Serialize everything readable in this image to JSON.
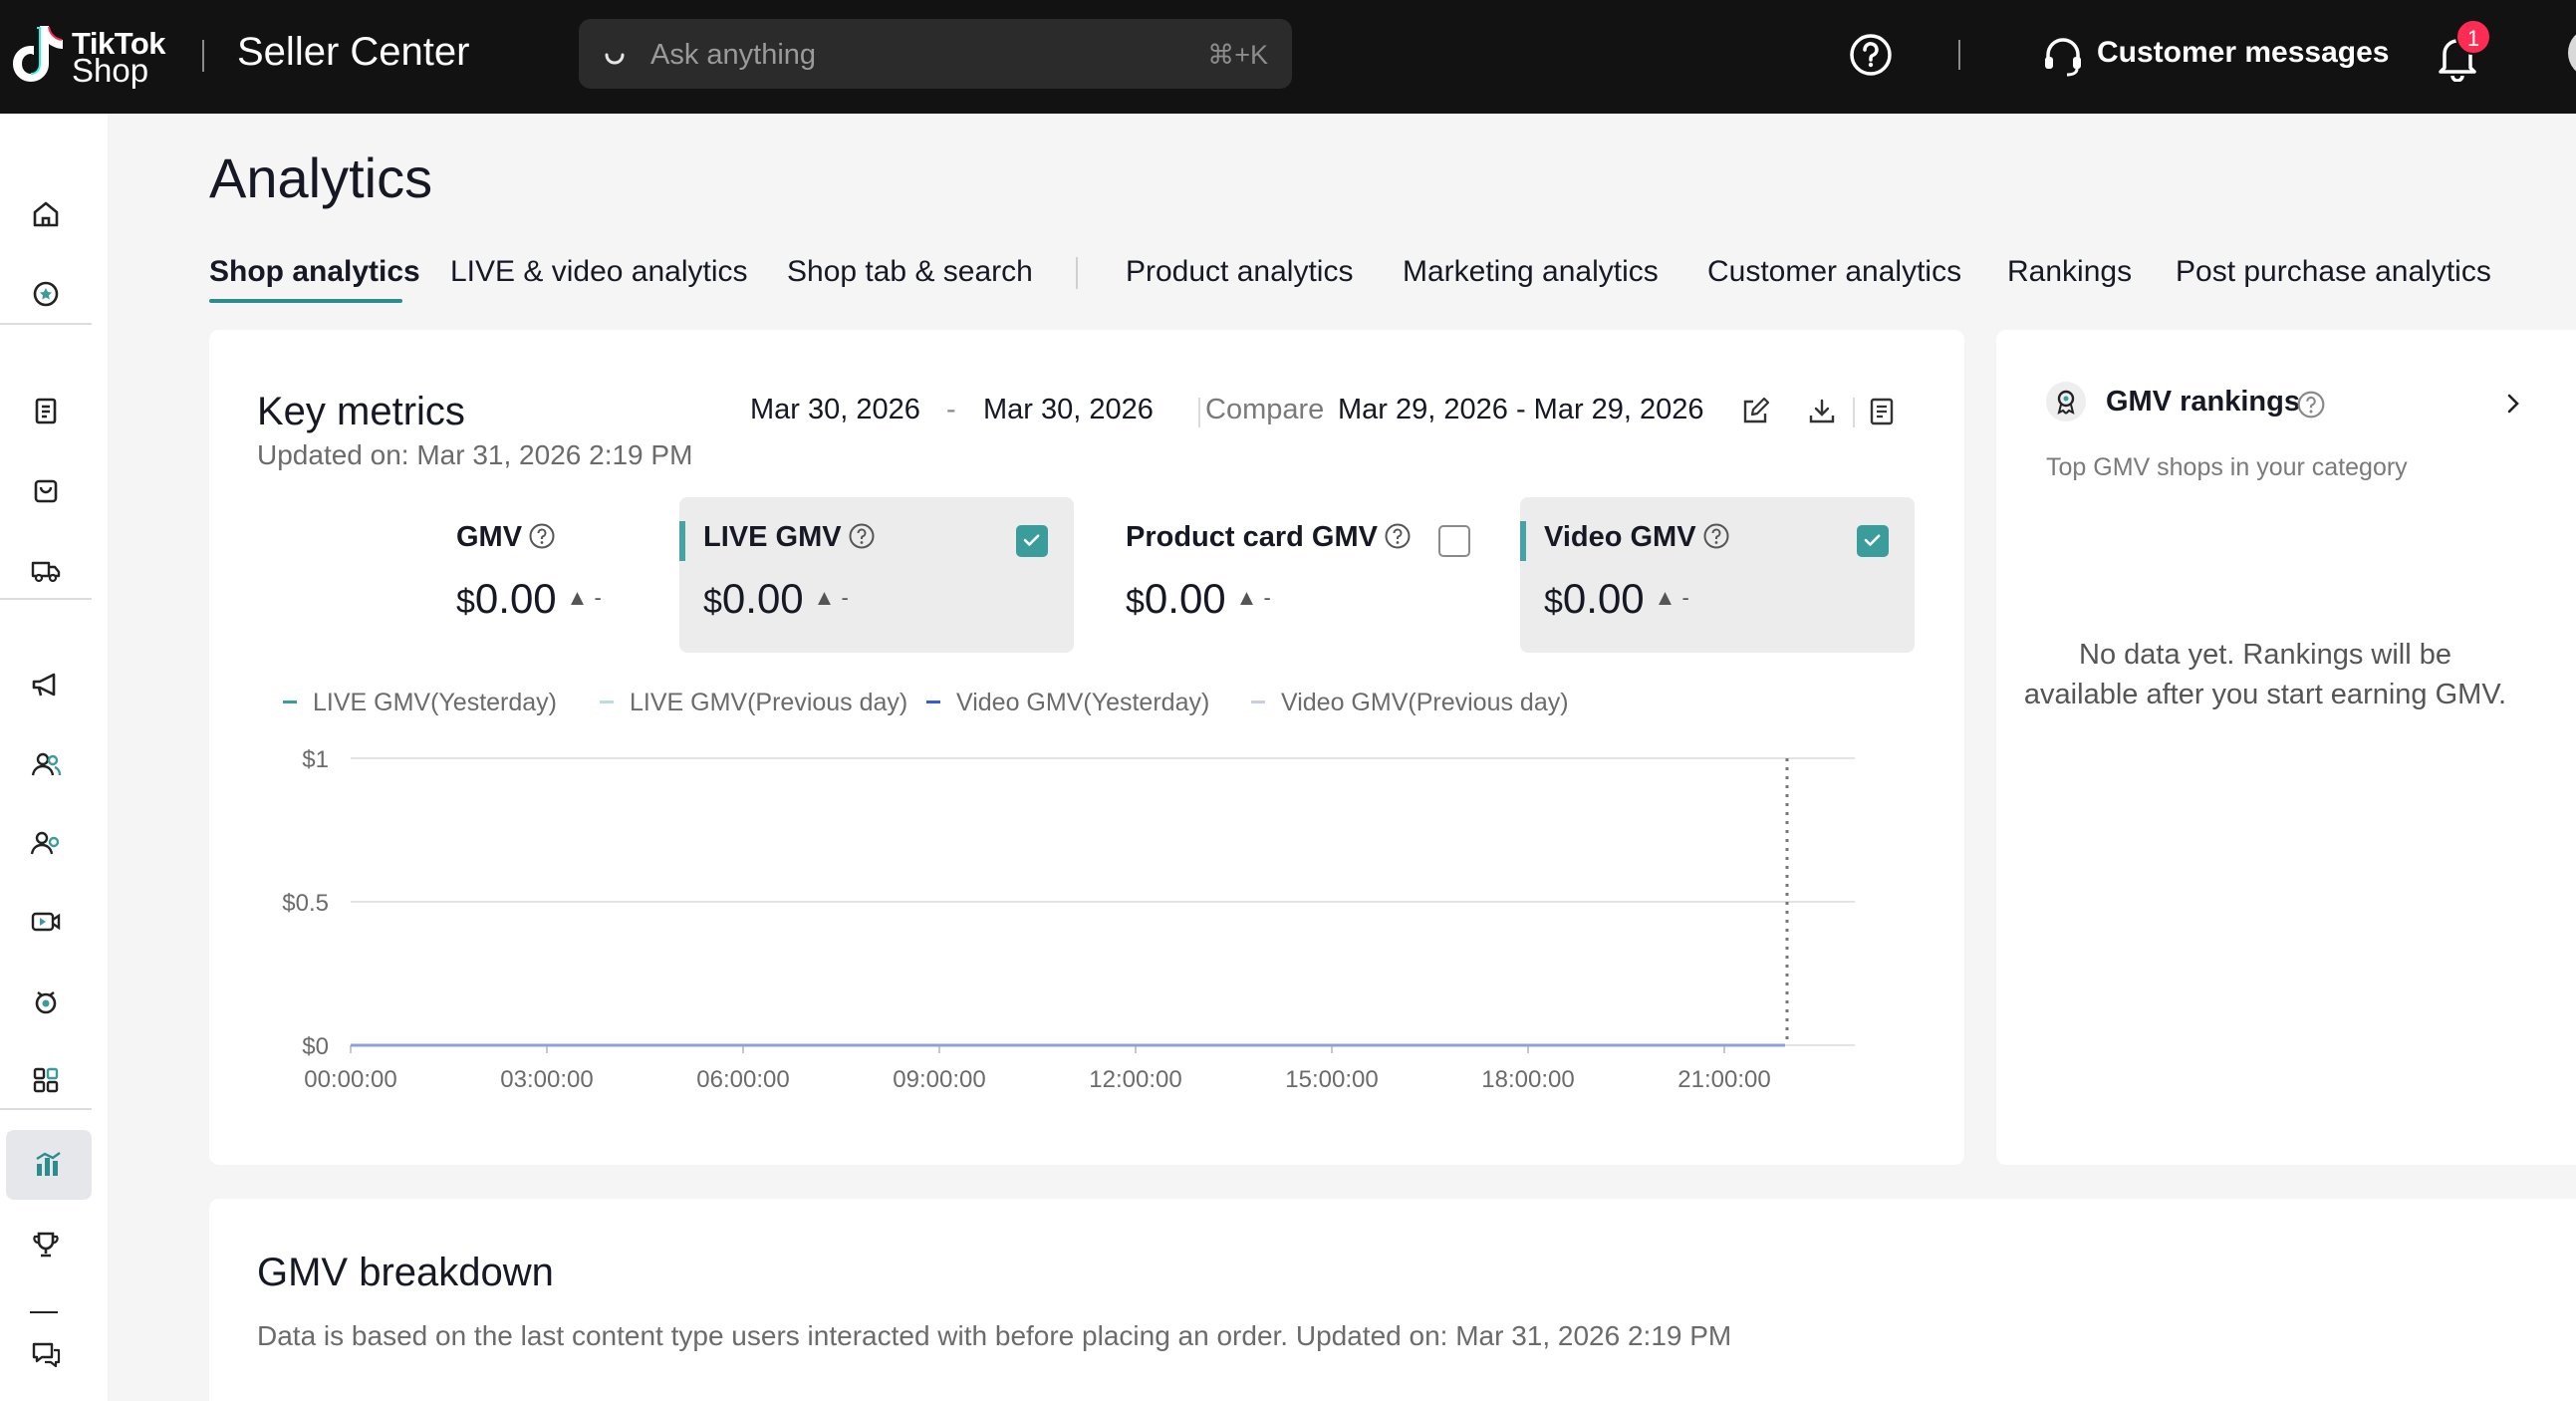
{
  "topbar": {
    "logo_line1": "TikTok",
    "logo_line2": "Shop",
    "app_title": "Seller Center",
    "search": {
      "placeholder": "Ask anything",
      "shortcut": "⌘+K"
    },
    "customer_messages_label": "Customer messages",
    "notification_count": "1"
  },
  "sidebar": {
    "items": [
      {
        "icon": "home-icon"
      },
      {
        "icon": "star-badge-icon"
      },
      {
        "icon": "clipboard-icon"
      },
      {
        "icon": "shopping-bag-icon"
      },
      {
        "icon": "delivery-truck-icon"
      },
      {
        "icon": "megaphone-icon"
      },
      {
        "icon": "users-icon"
      },
      {
        "icon": "user-group-icon"
      },
      {
        "icon": "video-camera-icon"
      },
      {
        "icon": "alarm-badge-icon"
      },
      {
        "icon": "apps-grid-icon"
      },
      {
        "icon": "analytics-chart-icon",
        "active": true
      },
      {
        "icon": "trophy-icon"
      },
      {
        "icon": "chat-icon"
      }
    ]
  },
  "page": {
    "title": "Analytics",
    "tabs": [
      {
        "label": "Shop analytics",
        "active": true
      },
      {
        "label": "LIVE & video analytics"
      },
      {
        "label": "Shop tab & search"
      },
      {
        "label": "Product analytics"
      },
      {
        "label": "Marketing analytics"
      },
      {
        "label": "Customer analytics"
      },
      {
        "label": "Rankings"
      },
      {
        "label": "Post purchase analytics"
      }
    ]
  },
  "key_metrics": {
    "title": "Key metrics",
    "updated": "Updated on: Mar 31, 2026 2:19 PM",
    "date_start": "Mar 30, 2026",
    "date_dash": "-",
    "date_end": "Mar 30, 2026",
    "compare_label": "Compare",
    "compare_range": "Mar 29, 2026 - Mar 29, 2026",
    "metrics": [
      {
        "label": "GMV",
        "currency": "$",
        "value": "0.00",
        "trend": "▲ -",
        "checked": false,
        "selected": false
      },
      {
        "label": "LIVE GMV",
        "currency": "$",
        "value": "0.00",
        "trend": "▲ -",
        "checked": true,
        "selected": true
      },
      {
        "label": "Product card GMV",
        "currency": "$",
        "value": "0.00",
        "trend": "▲ -",
        "checked": false,
        "selected": false
      },
      {
        "label": "Video GMV",
        "currency": "$",
        "value": "0.00",
        "trend": "▲ -",
        "checked": true,
        "selected": true
      }
    ],
    "legend": [
      {
        "label": "LIVE GMV(Yesterday)",
        "color": "#3b9c9c"
      },
      {
        "label": "LIVE GMV(Previous day)",
        "color": "#b9dede"
      },
      {
        "label": "Video GMV(Yesterday)",
        "color": "#3a5bd9"
      },
      {
        "label": "Video GMV(Previous day)",
        "color": "#c7cfe8"
      }
    ]
  },
  "chart_data": {
    "type": "line",
    "x": [
      "00:00:00",
      "03:00:00",
      "06:00:00",
      "09:00:00",
      "12:00:00",
      "15:00:00",
      "18:00:00",
      "21:00:00"
    ],
    "y_ticks": [
      "$1",
      "$0.5",
      "$0"
    ],
    "ylim": [
      0,
      1
    ],
    "series": [
      {
        "name": "LIVE GMV(Yesterday)",
        "values": [
          0,
          0,
          0,
          0,
          0,
          0,
          0,
          0
        ]
      },
      {
        "name": "LIVE GMV(Previous day)",
        "values": [
          0,
          0,
          0,
          0,
          0,
          0,
          0,
          0
        ]
      },
      {
        "name": "Video GMV(Yesterday)",
        "values": [
          0,
          0,
          0,
          0,
          0,
          0,
          0,
          0
        ]
      },
      {
        "name": "Video GMV(Previous day)",
        "values": [
          0,
          0,
          0,
          0,
          0,
          0,
          0,
          0
        ]
      }
    ],
    "grid": true,
    "legend_position": "top-left"
  },
  "gmv_rankings": {
    "title": "GMV rankings",
    "subtitle": "Top GMV shops in your category",
    "empty_line1": "No data yet. Rankings will be",
    "empty_line2": "available after you start earning GMV."
  },
  "gmv_breakdown": {
    "title": "GMV breakdown",
    "subtitle": "Data is based on the last content type users interacted with before placing an order.  Updated on: Mar 31, 2026 2:19 PM"
  }
}
